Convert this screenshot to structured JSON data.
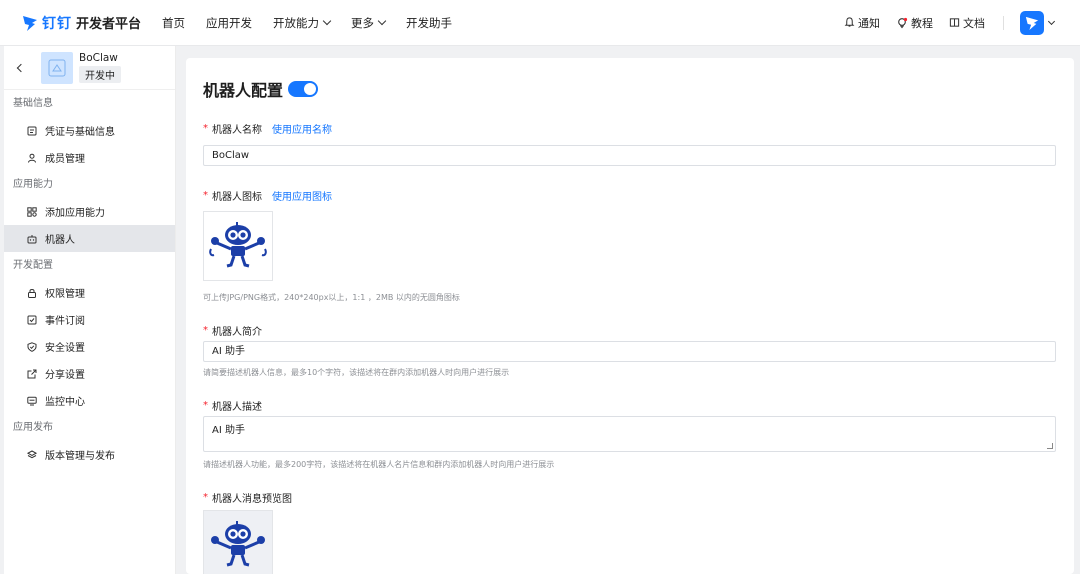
{
  "brand": {
    "name": "钉钉",
    "title": "开发者平台",
    "accent": "#1677ff"
  },
  "nav": [
    {
      "label": "首页"
    },
    {
      "label": "应用开发"
    },
    {
      "label": "开放能力",
      "dropdown": true
    },
    {
      "label": "更多",
      "dropdown": true
    },
    {
      "label": "开发助手"
    }
  ],
  "top_right": {
    "notify": "通知",
    "tutorial": "教程",
    "docs": "文档"
  },
  "app": {
    "name": "BoClaw",
    "status": "开发中"
  },
  "sidebar": {
    "sections": [
      {
        "title": "基础信息",
        "items": [
          {
            "label": "凭证与基础信息",
            "icon": "credential-icon"
          },
          {
            "label": "成员管理",
            "icon": "user-icon"
          }
        ]
      },
      {
        "title": "应用能力",
        "items": [
          {
            "label": "添加应用能力",
            "icon": "apps-icon"
          },
          {
            "label": "机器人",
            "icon": "robot-icon",
            "active": true
          }
        ]
      },
      {
        "title": "开发配置",
        "items": [
          {
            "label": "权限管理",
            "icon": "lock-icon"
          },
          {
            "label": "事件订阅",
            "icon": "event-icon"
          },
          {
            "label": "安全设置",
            "icon": "shield-icon"
          },
          {
            "label": "分享设置",
            "icon": "share-icon"
          },
          {
            "label": "监控中心",
            "icon": "monitor-icon"
          }
        ]
      },
      {
        "title": "应用发布",
        "items": [
          {
            "label": "版本管理与发布",
            "icon": "layers-icon"
          }
        ]
      }
    ]
  },
  "main": {
    "title": "机器人配置",
    "toggle_on": true,
    "name_label": "机器人名称",
    "name_link": "使用应用名称",
    "name_value": "BoClaw",
    "icon_label": "机器人图标",
    "icon_link": "使用应用图标",
    "icon_hint": "可上传JPG/PNG格式，240*240px以上，1:1 ，2MB 以内的无圆角图标",
    "intro_label": "机器人简介",
    "intro_value": "AI 助手",
    "intro_hint": "请简要描述机器人信息，最多10个字符，该描述将在群内添加机器人时向用户进行展示",
    "desc_label": "机器人描述",
    "desc_value": "AI 助手",
    "desc_hint": "请描述机器人功能，最多200字符，该描述将在机器人名片信息和群内添加机器人时向用户进行展示",
    "preview_label": "机器人消息预览图"
  }
}
